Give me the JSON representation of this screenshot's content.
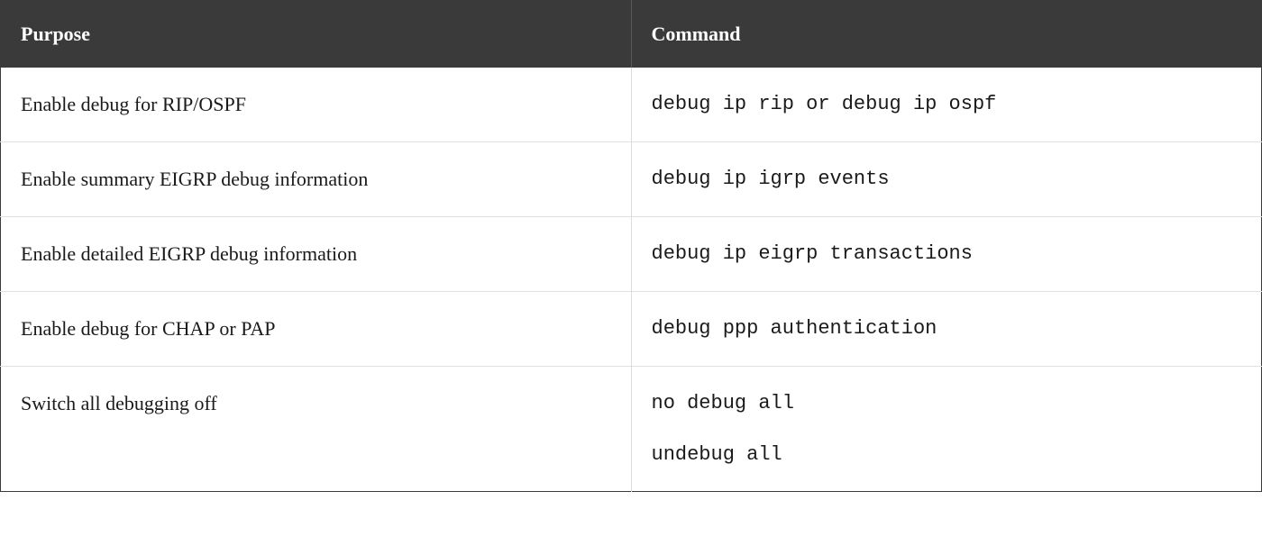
{
  "table": {
    "headers": {
      "purpose": "Purpose",
      "command": "Command"
    },
    "rows": [
      {
        "purpose": "Enable debug for RIP/OSPF",
        "commands": [
          "debug ip rip or debug ip ospf"
        ]
      },
      {
        "purpose": "Enable summary EIGRP debug information",
        "commands": [
          "debug ip igrp events"
        ]
      },
      {
        "purpose": "Enable detailed EIGRP debug information",
        "commands": [
          "debug ip eigrp transactions"
        ]
      },
      {
        "purpose": "Enable debug for CHAP or PAP",
        "commands": [
          "debug ppp authentication"
        ]
      },
      {
        "purpose": "Switch all debugging off",
        "commands": [
          "no debug all",
          "undebug all"
        ]
      }
    ]
  }
}
